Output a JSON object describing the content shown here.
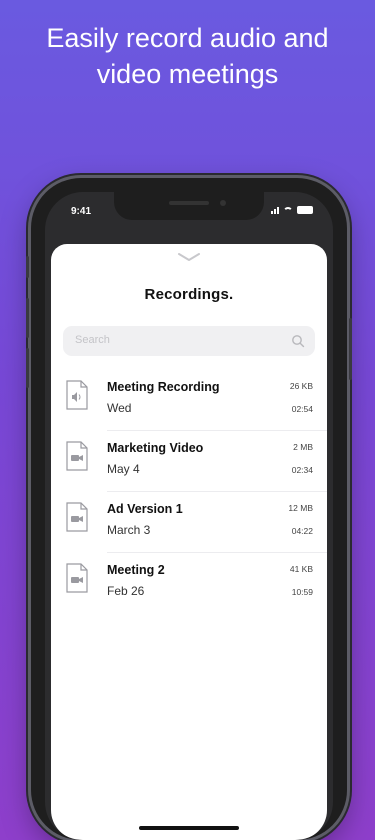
{
  "headline": {
    "line1": "Easily record audio and",
    "line2": "video meetings"
  },
  "status_bar": {
    "time": "9:41"
  },
  "screen": {
    "title": "Recordings.",
    "search": {
      "placeholder": "Search"
    },
    "recordings": [
      {
        "name": "Meeting Recording",
        "date": "Wed",
        "size": "26 KB",
        "duration": "02:54",
        "icon": "audio-file-icon"
      },
      {
        "name": "Marketing Video",
        "date": "May 4",
        "size": "2 MB",
        "duration": "02:34",
        "icon": "video-file-icon"
      },
      {
        "name": "Ad Version 1",
        "date": "March 3",
        "size": "12 MB",
        "duration": "04:22",
        "icon": "video-file-icon"
      },
      {
        "name": "Meeting 2",
        "date": "Feb 26",
        "size": "41 KB",
        "duration": "10:59",
        "icon": "video-file-icon"
      }
    ]
  },
  "colors": {
    "background_top": "#6a5ae0",
    "background_bottom": "#8e3fcb",
    "sheet": "#ffffff"
  }
}
